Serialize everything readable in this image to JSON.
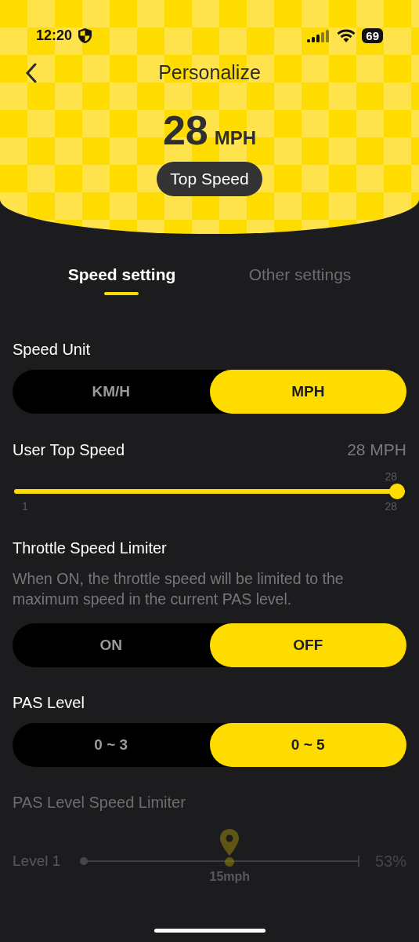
{
  "status_bar": {
    "time": "12:20",
    "battery": "69"
  },
  "header": {
    "title": "Personalize",
    "speed": "28",
    "unit": "MPH",
    "badge": "Top Speed"
  },
  "tabs": [
    {
      "label": "Speed setting",
      "selected": true
    },
    {
      "label": "Other settings",
      "selected": false
    }
  ],
  "settings": [
    {
      "kind": "segmented",
      "title": "Speed Unit",
      "options": [
        {
          "label": "KM/H",
          "selected": false
        },
        {
          "label": "MPH",
          "selected": true
        }
      ]
    },
    {
      "kind": "slider",
      "title": "User Top Speed",
      "reading": "28 MPH",
      "level": 1,
      "top_label": "28",
      "min_label": "1",
      "max_label": "28"
    },
    {
      "kind": "segmented",
      "title": "Throttle Speed Limiter",
      "description": "When ON, the throttle speed will be limited to the maximum speed in the current PAS level.",
      "options": [
        {
          "label": "ON",
          "selected": false
        },
        {
          "label": "OFF",
          "selected": true
        }
      ]
    },
    {
      "kind": "segmented",
      "title": "PAS Level",
      "options": [
        {
          "label": "0 ~ 3",
          "selected": false
        },
        {
          "label": "0 ~ 5",
          "selected": true
        }
      ]
    },
    {
      "kind": "limiter",
      "title": "PAS Level Speed Limiter",
      "disabled": true,
      "rows": [
        {
          "label": "Level 1",
          "level": 0.53,
          "value": "15mph",
          "percent": "53%"
        }
      ]
    }
  ]
}
